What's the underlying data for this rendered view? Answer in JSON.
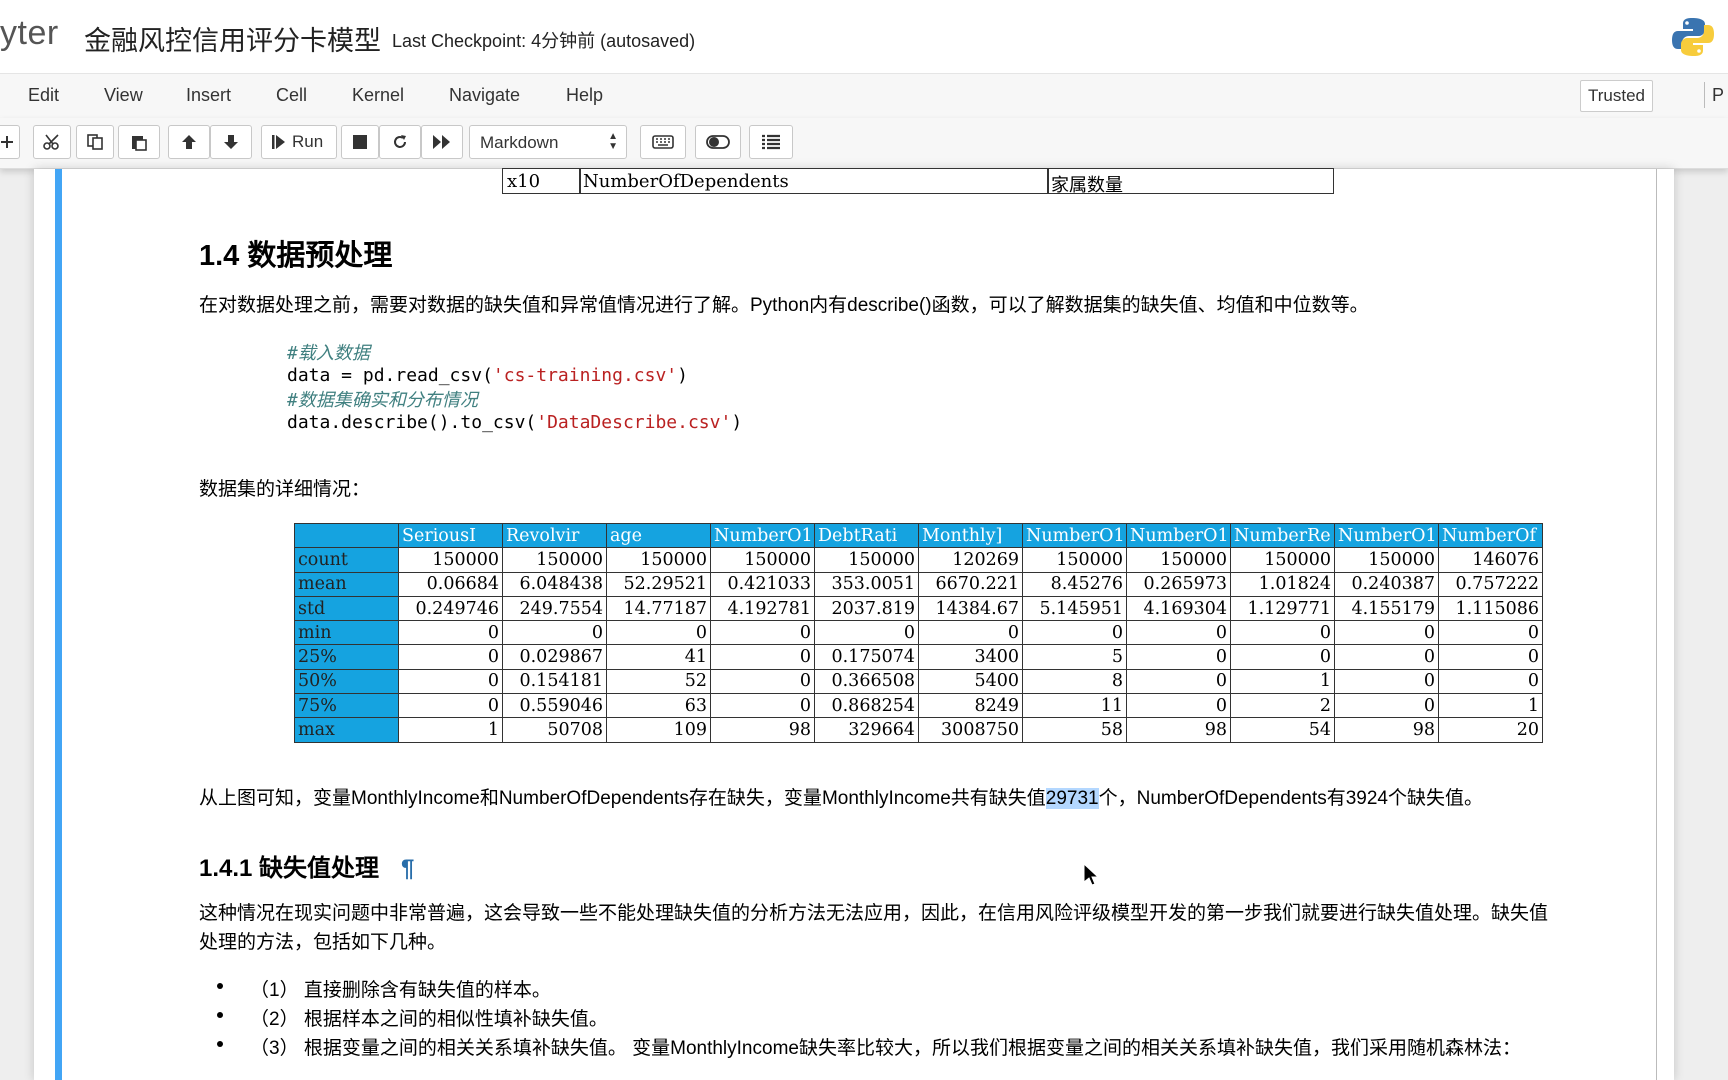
{
  "header": {
    "logo_text": "yter",
    "notebook_name": "金融风控信用评分卡模型",
    "checkpoint": "Last Checkpoint: 4分钟前   (autosaved)",
    "python_logo_icon": "python-logo-icon"
  },
  "menubar": {
    "items": [
      "Edit",
      "View",
      "Insert",
      "Cell",
      "Kernel",
      "Navigate",
      "Help"
    ],
    "trusted": "Trusted",
    "kernel_truncated": "P"
  },
  "toolbar": {
    "run_label": "Run",
    "cell_type": "Markdown",
    "icons": [
      "plus-icon",
      "cut-icon",
      "copy-icon",
      "paste-icon",
      "arrow-up-icon",
      "arrow-down-icon",
      "run-icon",
      "stop-icon",
      "restart-icon",
      "fast-forward-icon",
      "keyboard-icon",
      "toggle-icon",
      "list-icon"
    ]
  },
  "content": {
    "var_row": {
      "code": "x10",
      "name": "NumberOfDependents",
      "desc": "家属数量"
    },
    "section_title": "1.4  数据预处理",
    "intro": "在对数据处理之前，需要对数据的缺失值和异常值情况进行了解。Python内有describe()函数，可以了解数据集的缺失值、均值和中位数等。",
    "code": {
      "comment1": "#载入数据",
      "line1_pre": "data = pd.read_csv(",
      "line1_str": "'cs-training.csv'",
      "line1_post": ")",
      "comment2": "#数据集确实和分布情况",
      "line2_pre": "data.describe().to_csv(",
      "line2_str": "'DataDescribe.csv'",
      "line2_post": ")"
    },
    "table_caption": "数据集的详细情况：",
    "stats_table": {
      "headers": [
        "SeriousI",
        "Revolvir",
        "age",
        "NumberO1",
        "DebtRati",
        "Monthly]",
        "NumberO1",
        "NumberO1",
        "NumberRe",
        "NumberO1",
        "NumberOf"
      ],
      "rows": [
        {
          "label": "count",
          "values": [
            "150000",
            "150000",
            "150000",
            "150000",
            "150000",
            "120269",
            "150000",
            "150000",
            "150000",
            "150000",
            "146076"
          ]
        },
        {
          "label": "mean",
          "values": [
            "0.06684",
            "6.048438",
            "52.29521",
            "0.421033",
            "353.0051",
            "6670.221",
            "8.45276",
            "0.265973",
            "1.01824",
            "0.240387",
            "0.757222"
          ]
        },
        {
          "label": "std",
          "values": [
            "0.249746",
            "249.7554",
            "14.77187",
            "4.192781",
            "2037.819",
            "14384.67",
            "5.145951",
            "4.169304",
            "1.129771",
            "4.155179",
            "1.115086"
          ]
        },
        {
          "label": "min",
          "values": [
            "0",
            "0",
            "0",
            "0",
            "0",
            "0",
            "0",
            "0",
            "0",
            "0",
            "0"
          ]
        },
        {
          "label": "25%",
          "values": [
            "0",
            "0.029867",
            "41",
            "0",
            "0.175074",
            "3400",
            "5",
            "0",
            "0",
            "0",
            "0"
          ]
        },
        {
          "label": "50%",
          "values": [
            "0",
            "0.154181",
            "52",
            "0",
            "0.366508",
            "5400",
            "8",
            "0",
            "1",
            "0",
            "0"
          ]
        },
        {
          "label": "75%",
          "values": [
            "0",
            "0.559046",
            "63",
            "0",
            "0.868254",
            "8249",
            "11",
            "0",
            "2",
            "0",
            "1"
          ]
        },
        {
          "label": "max",
          "values": [
            "1",
            "50708",
            "109",
            "98",
            "329664",
            "3008750",
            "58",
            "98",
            "54",
            "98",
            "20"
          ]
        }
      ]
    },
    "missing_pre": "从上图可知，变量MonthlyIncome和NumberOfDependents存在缺失，变量MonthlyIncome共有缺失值",
    "missing_hl": "29731",
    "missing_post": "个，NumberOfDependents有3924个缺失值。",
    "subsection_title": "1.4.1  缺失值处理",
    "anchor": "¶",
    "desc_line1": "这种情况在现实问题中非常普遍，这会导致一些不能处理缺失值的分析方法无法应用，因此，在信用风险评级模型开发的第一步我们就要进行缺失值处理。缺失值",
    "desc_line2": "处理的方法，包括如下几种。",
    "bullets": [
      "（1）  直接删除含有缺失值的样本。",
      "（2）  根据样本之间的相似性填补缺失值。",
      "（3）  根据变量之间的相关关系填补缺失值。 变量MonthlyIncome缺失率比较大，所以我们根据变量之间的相关关系填补缺失值，我们采用随机森林法："
    ]
  },
  "colors": {
    "accent": "#42a5f5",
    "table_header": "#15a3e0",
    "highlight": "#b3d7ff"
  }
}
